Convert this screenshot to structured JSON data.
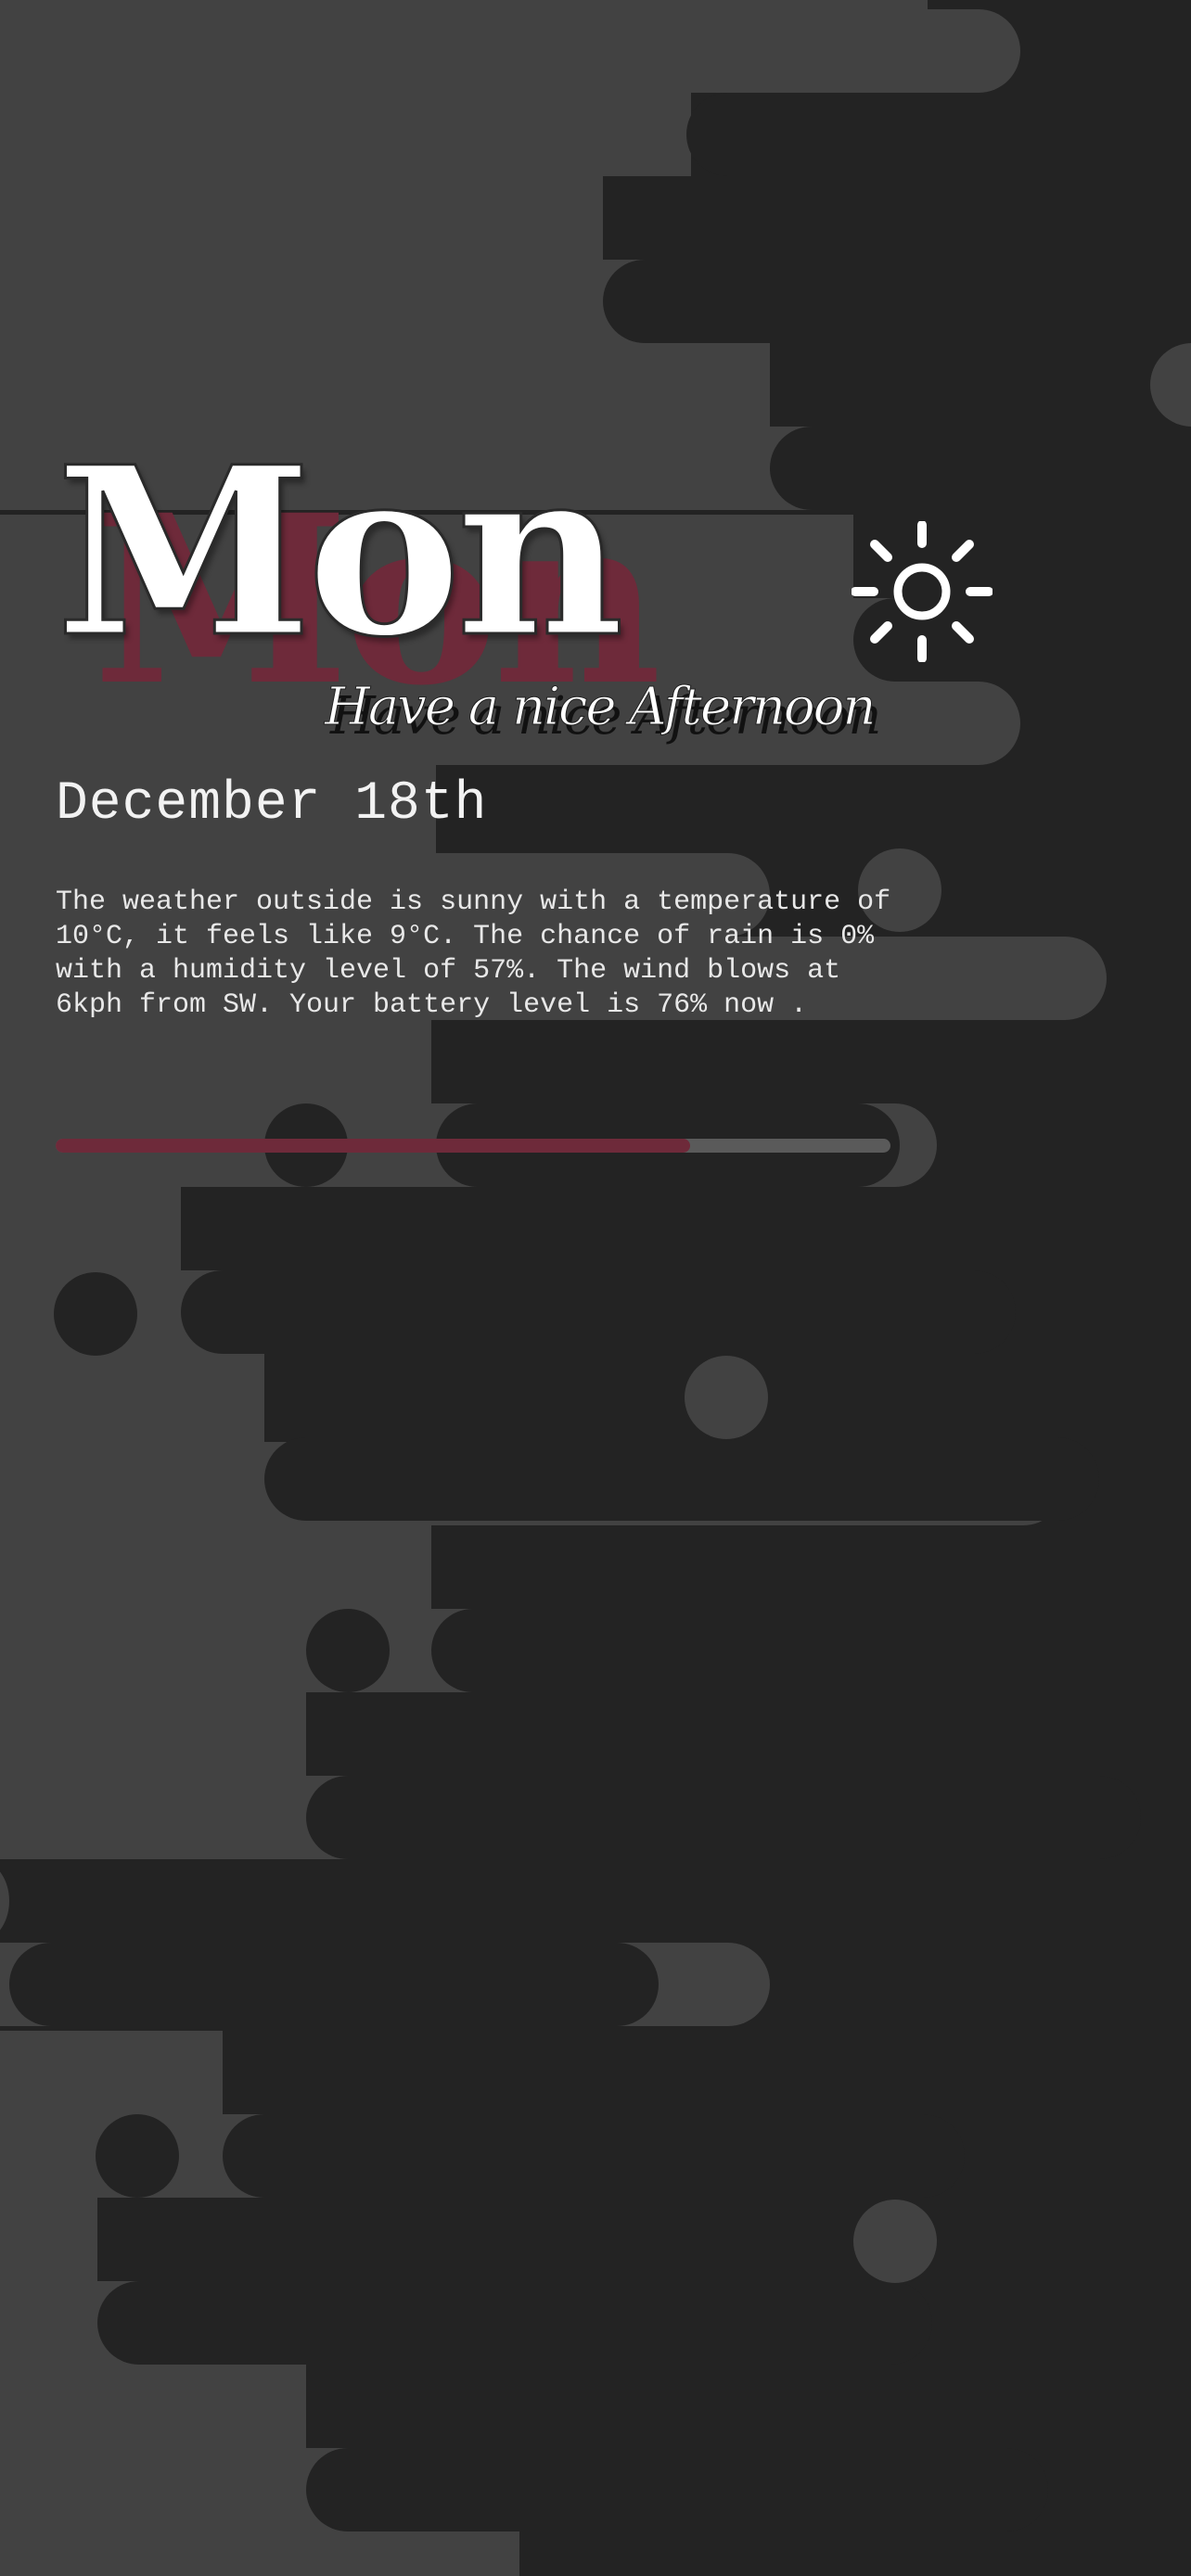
{
  "widget": {
    "day": "Mon",
    "greeting": "Have a nice Afternoon",
    "date": "December 18th",
    "description": "The weather outside is sunny with a temperature of 10°C, it feels like 9°C. The chance of rain is 0% with a humidity level of 57%. The wind blows at 6kph from SW. Your battery level is 76% now .",
    "weather_icon": "sun-icon",
    "battery_level": 0.76
  },
  "colors": {
    "background": "#232323",
    "stripe": "#424242",
    "accent": "#6e2a3a",
    "text": "#ffffff"
  }
}
